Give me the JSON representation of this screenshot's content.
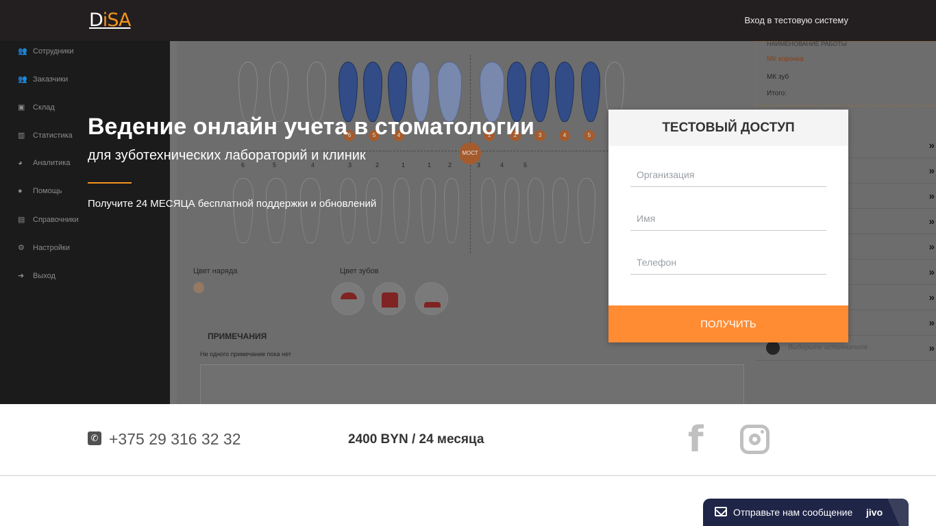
{
  "header": {
    "logo_d": "D",
    "logo_i": "i",
    "logo_sa": "SA",
    "login_link": "Вход в тестовую систему"
  },
  "background_app": {
    "sidebar": [
      {
        "icon": "users-icon",
        "label": "Сотрудники"
      },
      {
        "icon": "users-icon",
        "label": "Заказчики"
      },
      {
        "icon": "cart-icon",
        "label": "Склад"
      },
      {
        "icon": "bar-chart-icon",
        "label": "Статистика"
      },
      {
        "icon": "pie-chart-icon",
        "label": "Аналитика"
      },
      {
        "icon": "question-icon",
        "label": "Помощь"
      },
      {
        "icon": "book-icon",
        "label": "Справочники"
      },
      {
        "icon": "gears-icon",
        "label": "Настройки"
      },
      {
        "icon": "exit-icon",
        "label": "Выход"
      }
    ],
    "work_box": {
      "heading": "НАИМЕНОВАНИЕ РАБОТЫ",
      "item1": "МК коронка",
      "item2": "МК зуб",
      "total": "Итого:"
    },
    "bridge_label": "МОСТ",
    "order_color_label": "Цвет наряда",
    "teeth_color_label": "Цвет зубов",
    "notes_title": "ПРИМЕЧАНИЯ",
    "notes_empty": "Ни одного примечание пока нет",
    "assignee_placeholder": "Выберите исполнителя",
    "upper_numbers": [
      "6",
      "5",
      "4",
      "3",
      "2",
      "1",
      "1",
      "2",
      "3",
      "4",
      "5"
    ],
    "lower_numbers": [
      "6",
      "5",
      "4",
      "3",
      "2",
      "1",
      "1",
      "2",
      "3",
      "4",
      "5"
    ]
  },
  "hero": {
    "title": "Ведение онлайн учета в стоматологии",
    "subtitle": "для зуботехнических лабораторий и клиник",
    "promo": "Получите 24 МЕСЯЦА бесплатной поддержки и обновлений"
  },
  "form": {
    "title": "ТЕСТОВЫЙ ДОСТУП",
    "org_placeholder": "Организация",
    "name_placeholder": "Имя",
    "phone_placeholder": "Телефон",
    "submit_label": "ПОЛУЧИТЬ"
  },
  "contact": {
    "phone": "+375 29 316 32 32",
    "price": "2400 BYN / 24 месяца"
  },
  "chat": {
    "label": "Отправьте нам сообщение",
    "brand": "jivo"
  },
  "colors": {
    "accent": "#ff8c33",
    "topbar": "#231f20",
    "chat": "#1f2547"
  }
}
